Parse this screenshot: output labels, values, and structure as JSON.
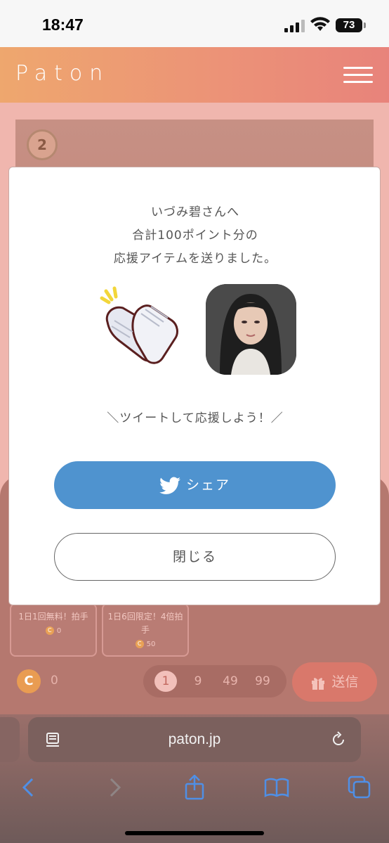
{
  "status_bar": {
    "time": "18:47",
    "battery": "73"
  },
  "header": {
    "logo": "Paton"
  },
  "page": {
    "rank_badge": "2",
    "items": [
      {
        "label": "1日1回無料！拍手",
        "price": "0"
      },
      {
        "label": "1日6回限定！4倍拍手",
        "price": "50"
      }
    ],
    "coin_symbol": "C",
    "coin_balance": "0",
    "quantities": [
      "1",
      "9",
      "49",
      "99"
    ],
    "send_label": "送信"
  },
  "modal": {
    "message_line1": "いづみ碧さんへ",
    "message_line2": "合計100ポイント分の",
    "message_line3": "応援アイテムを送りました。",
    "prompt": "＼ツイートして応援しよう！／",
    "share_label": "シェア",
    "close_label": "閉じる"
  },
  "browser": {
    "url": "paton.jp"
  }
}
